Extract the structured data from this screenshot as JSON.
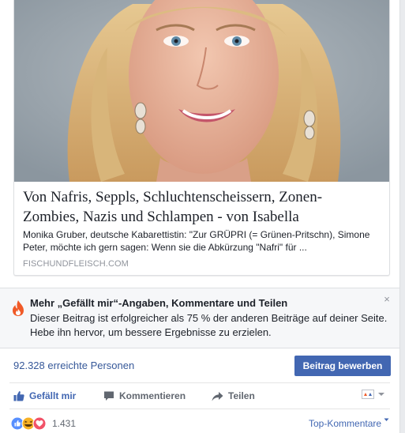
{
  "preview": {
    "title_line1": "Von Nafris, Seppls, Schluchtenscheissern, Zonen-",
    "title_line2": "Zombies, Nazis und Schlampen - von Isabella",
    "desc_line1": "Monika Gruber, deutsche Kabarettistin: \"Zur GRÜPRI (= Grünen-Pritschn), Simone",
    "desc_line2": "Peter, möchte ich gern sagen: Wenn sie die Abkürzung \"Nafri\" für ...",
    "domain": "FISCHUNDFLEISCH.COM"
  },
  "insight": {
    "title": "Mehr „Gefällt mir“-Angaben, Kommentare und Teilen",
    "body": "Dieser Beitrag ist erfolgreicher als 75 % der anderen Beiträge auf deiner Seite. Hebe ihn hervor, um bessere Ergebnisse zu erzielen.",
    "close": "×",
    "icon": "fire-icon"
  },
  "reach": {
    "text": "92.328 erreichte Personen",
    "boost_label": "Beitrag bewerben"
  },
  "actions": {
    "like": "Gefällt mir",
    "comment": "Kommentieren",
    "share": "Teilen"
  },
  "reactions": {
    "count": "1.431",
    "sort": "Top-Kommentare"
  },
  "colors": {
    "brand": "#4267b2",
    "link": "#365899",
    "like_reaction": "#5890ff",
    "love_reaction": "#f25268",
    "haha_reaction": "#f7b125",
    "fire": "#f05a28"
  }
}
